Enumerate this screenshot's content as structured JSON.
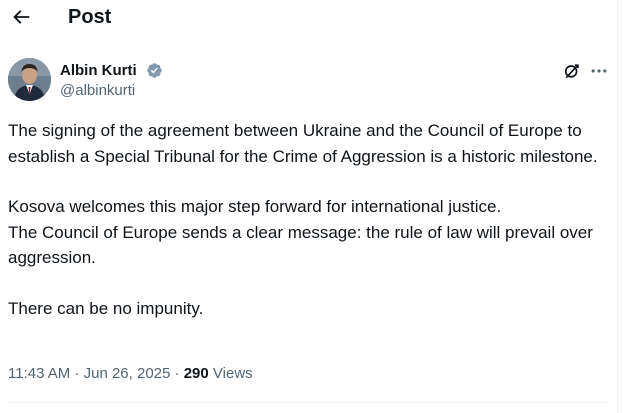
{
  "header": {
    "title": "Post",
    "back_icon": "arrow-left-icon"
  },
  "author": {
    "name": "Albin Kurti",
    "handle": "@albinkurti",
    "verified": true,
    "verified_color": "#1d9bf0",
    "avatar_icon": "avatar-photo"
  },
  "actions": {
    "grok_icon": "grok-icon",
    "more_icon": "more-horizontal-icon"
  },
  "post": {
    "paragraph_1": "The signing of the agreement between Ukraine and the Council of Europe to establish a Special Tribunal for the Crime of Aggression is a historic milestone.",
    "paragraph_2_line_1": "Kosova welcomes this major step forward for international justice.",
    "paragraph_2_line_2": "The Council of Europe sends a clear message: the rule of law will prevail over aggression.",
    "paragraph_3": "There can be no impunity."
  },
  "meta": {
    "time": "11:43 AM",
    "separator": " · ",
    "date": "Jun 26, 2025",
    "views_count": "290",
    "views_label": "Views"
  }
}
